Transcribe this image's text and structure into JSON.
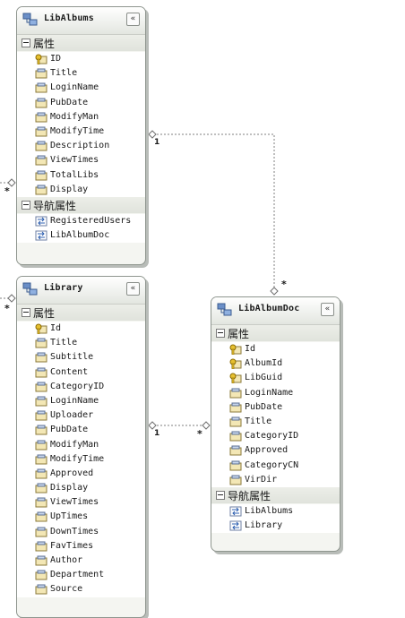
{
  "entities": [
    {
      "name": "LibAlbums",
      "collapse_glyph": "«",
      "properties_label": "属性",
      "nav_label": "导航属性",
      "properties": [
        {
          "name": "ID",
          "key": true
        },
        {
          "name": "Title"
        },
        {
          "name": "LoginName"
        },
        {
          "name": "PubDate"
        },
        {
          "name": "ModifyMan"
        },
        {
          "name": "ModifyTime"
        },
        {
          "name": "Description"
        },
        {
          "name": "ViewTimes"
        },
        {
          "name": "TotalLibs"
        },
        {
          "name": "Display"
        }
      ],
      "nav_properties": [
        {
          "name": "RegisteredUsers"
        },
        {
          "name": "LibAlbumDoc"
        }
      ]
    },
    {
      "name": "Library",
      "collapse_glyph": "«",
      "properties_label": "属性",
      "properties": [
        {
          "name": "Id",
          "key": true
        },
        {
          "name": "Title"
        },
        {
          "name": "Subtitle"
        },
        {
          "name": "Content"
        },
        {
          "name": "CategoryID"
        },
        {
          "name": "LoginName"
        },
        {
          "name": "Uploader"
        },
        {
          "name": "PubDate"
        },
        {
          "name": "ModifyMan"
        },
        {
          "name": "ModifyTime"
        },
        {
          "name": "Approved"
        },
        {
          "name": "Display"
        },
        {
          "name": "ViewTimes"
        },
        {
          "name": "UpTimes"
        },
        {
          "name": "DownTimes"
        },
        {
          "name": "FavTimes"
        },
        {
          "name": "Author"
        },
        {
          "name": "Department"
        },
        {
          "name": "Source"
        }
      ]
    },
    {
      "name": "LibAlbumDoc",
      "collapse_glyph": "«",
      "properties_label": "属性",
      "nav_label": "导航属性",
      "properties": [
        {
          "name": "Id",
          "key": true
        },
        {
          "name": "AlbumId",
          "key": true
        },
        {
          "name": "LibGuid",
          "key": true
        },
        {
          "name": "LoginName"
        },
        {
          "name": "PubDate"
        },
        {
          "name": "Title"
        },
        {
          "name": "CategoryID"
        },
        {
          "name": "Approved"
        },
        {
          "name": "CategoryCN"
        },
        {
          "name": "VirDir"
        }
      ],
      "nav_properties": [
        {
          "name": "LibAlbums"
        },
        {
          "name": "Library"
        }
      ]
    }
  ],
  "associations": [
    {
      "from": "LibAlbums",
      "to": "LibAlbumDoc",
      "from_mult": "1",
      "to_mult": "*"
    },
    {
      "from": "Library",
      "to": "LibAlbumDoc",
      "from_mult": "1",
      "to_mult": "*"
    },
    {
      "from": "offscreen-left",
      "to": "LibAlbums",
      "to_mult": "*"
    },
    {
      "from": "offscreen-left",
      "to": "Library",
      "to_mult": "*"
    }
  ]
}
